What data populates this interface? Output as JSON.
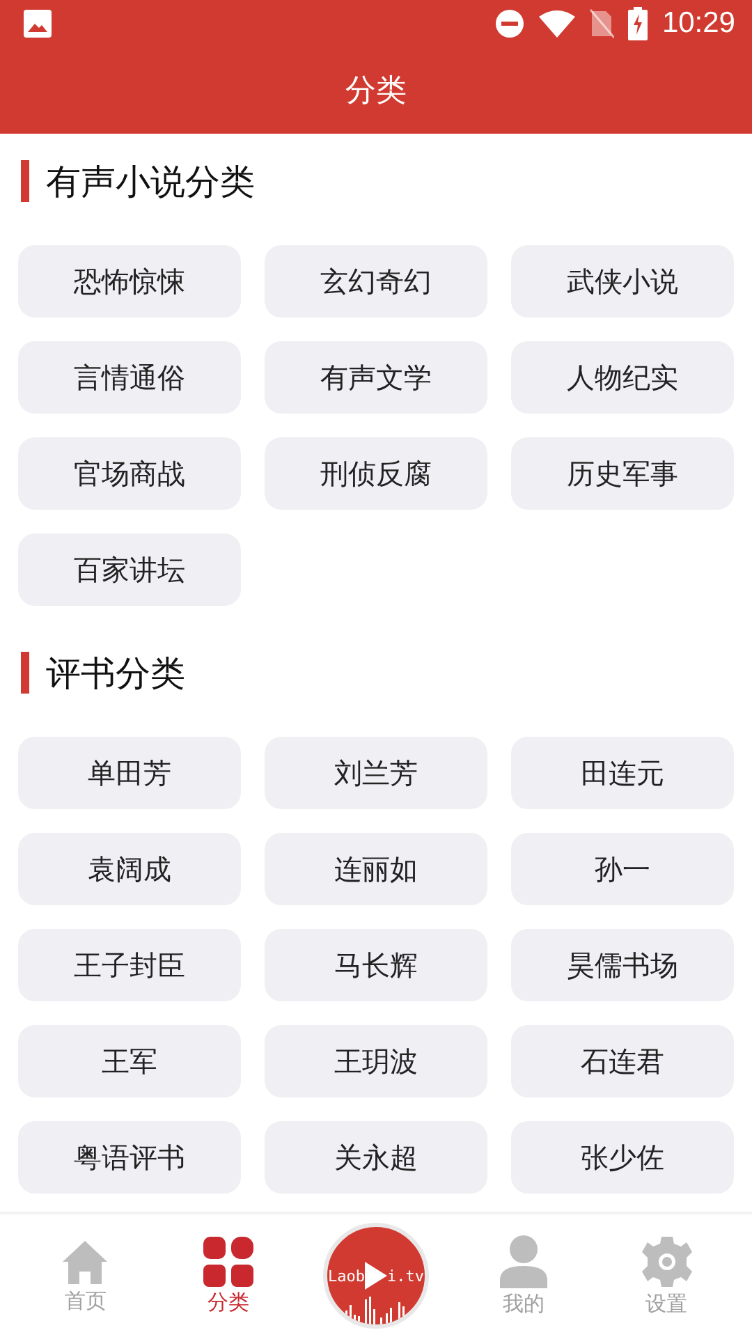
{
  "status_bar": {
    "time": "10:29"
  },
  "app_bar": {
    "title": "分类"
  },
  "sections": [
    {
      "title": "有声小说分类",
      "items": [
        "恐怖惊悚",
        "玄幻奇幻",
        "武侠小说",
        "言情通俗",
        "有声文学",
        "人物纪实",
        "官场商战",
        "刑侦反腐",
        "历史军事",
        "百家讲坛"
      ]
    },
    {
      "title": "评书分类",
      "items": [
        "单田芳",
        "刘兰芳",
        "田连元",
        "袁阔成",
        "连丽如",
        "孙一",
        "王子封臣",
        "马长辉",
        "昊儒书场",
        "王军",
        "王玥波",
        "石连君",
        "粤语评书",
        "关永超",
        "张少佐"
      ]
    }
  ],
  "bottom_nav": [
    {
      "kind": "tab",
      "label": "首页",
      "selected": false
    },
    {
      "kind": "tab",
      "label": "分类",
      "selected": true
    },
    {
      "kind": "logo",
      "text_before": "Laob",
      "text_after": "i.tv"
    },
    {
      "kind": "tab",
      "label": "我的",
      "selected": false
    },
    {
      "kind": "tab",
      "label": "设置",
      "selected": false
    }
  ]
}
